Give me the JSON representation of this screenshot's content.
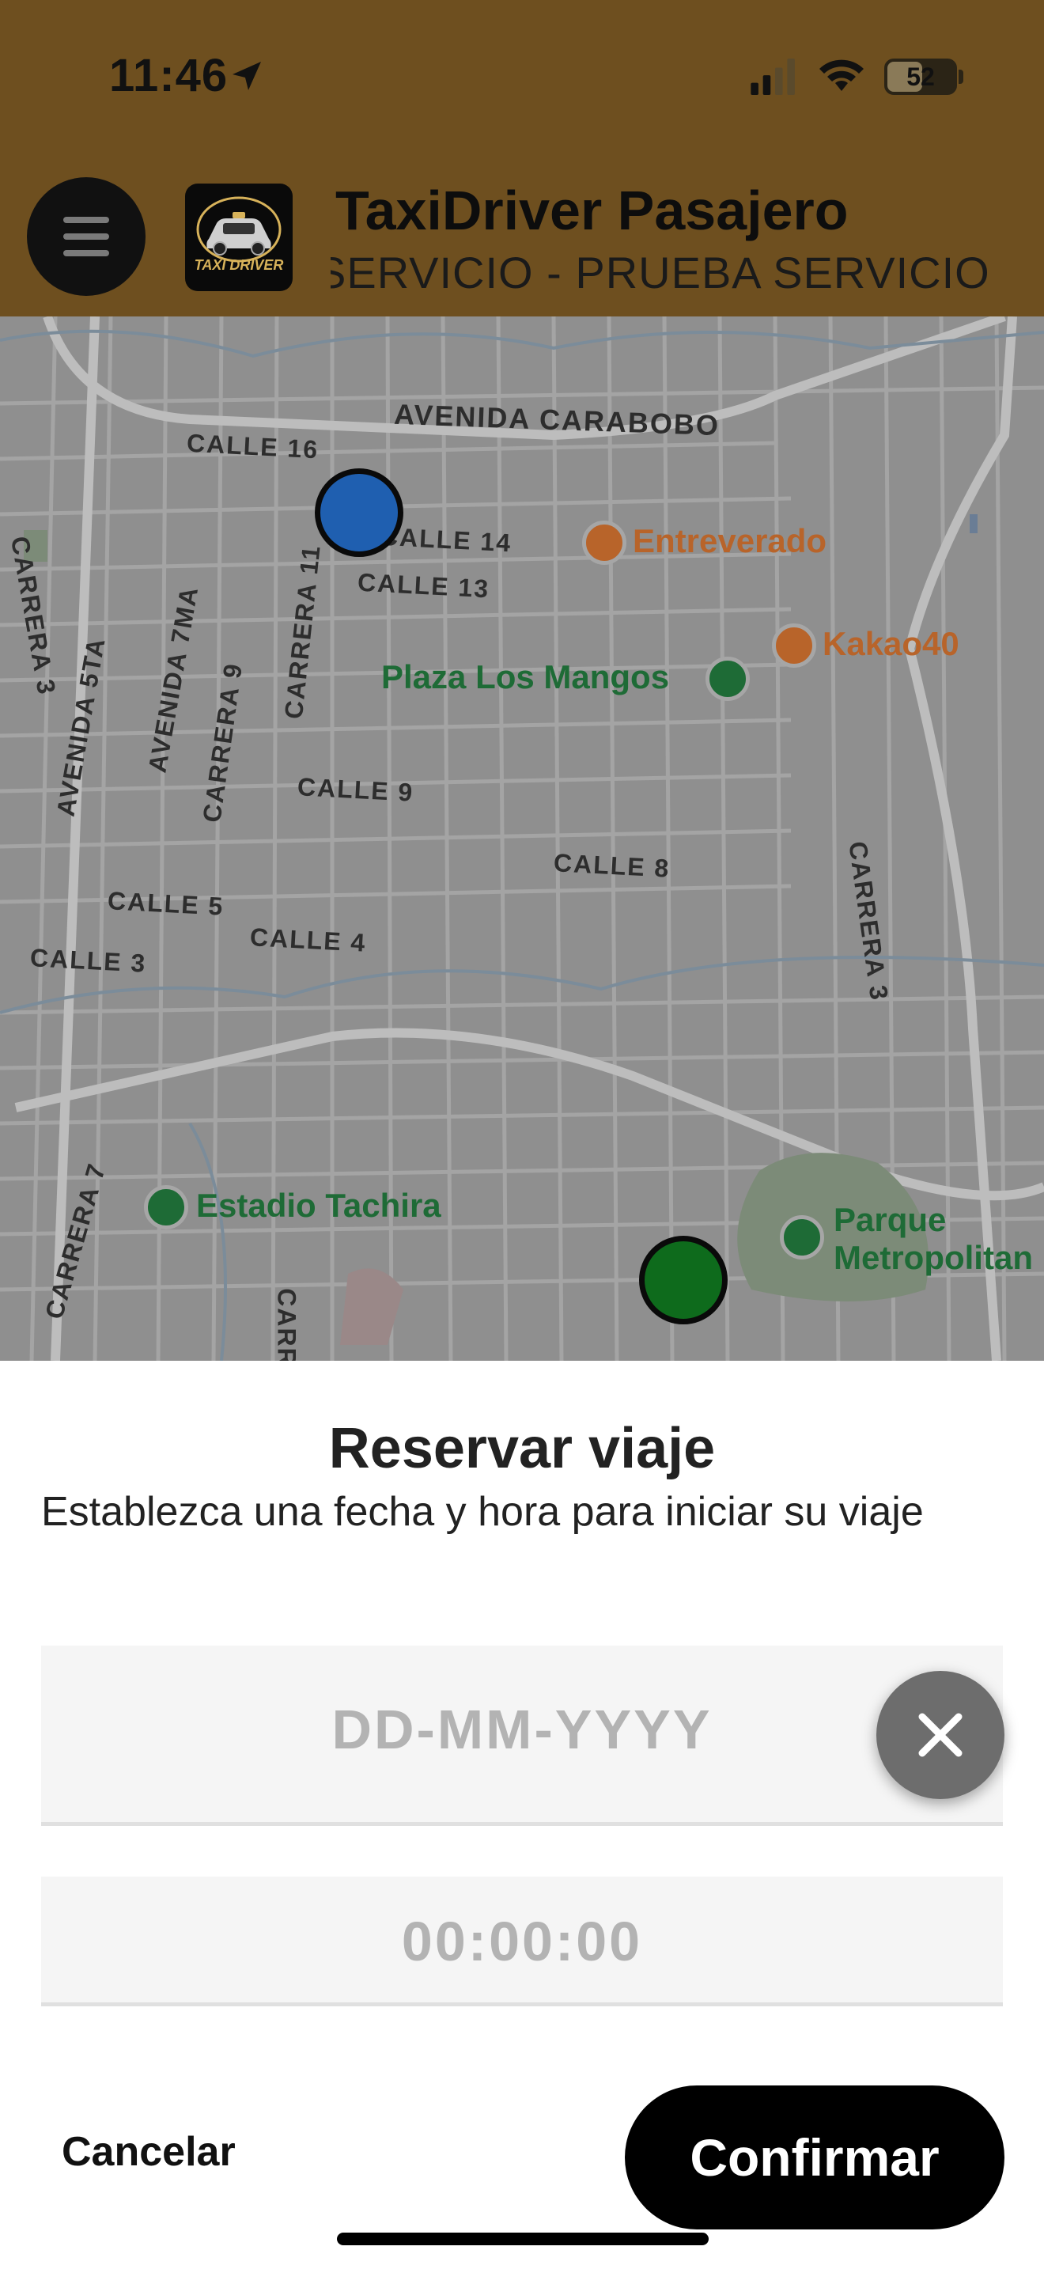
{
  "status_bar": {
    "time": "11:46",
    "battery": "52",
    "battery_level_pct": 52
  },
  "header": {
    "title": "TaxiDriver Pasajero",
    "subtitle": "SERVICIO - PRUEBA SERVICIO",
    "logo_text": "TAXI DRIVER",
    "bg_color": "#6e4f1f"
  },
  "map": {
    "street_labels": [
      "AVENIDA CARABOBO",
      "CALLE 16",
      "CALLE 14",
      "CALLE 13",
      "CALLE 9",
      "CALLE 8",
      "CALLE 5",
      "CALLE 4",
      "CALLE 3",
      "AVENIDA 5TA",
      "AVENIDA 7MA",
      "CARRERA 9",
      "CARRERA 11",
      "CARRERA 3",
      "CARRERA 7",
      "CARRERA 3",
      "CARR"
    ],
    "pois": [
      {
        "name": "Entreverado",
        "icon": "restaurant-icon",
        "color": "#b8642a"
      },
      {
        "name": "Kakao40",
        "icon": "ice-cream-icon",
        "color": "#b8642a"
      },
      {
        "name": "Plaza Los Mangos",
        "icon": "park-icon",
        "color": "#1e6b36"
      },
      {
        "name": "Estadio Tachira",
        "icon": "stadium-icon",
        "color": "#1e6b36"
      },
      {
        "name": "Parque Metropolitan",
        "icon": "tree-icon",
        "color": "#1e6b36"
      }
    ],
    "origin_pin_color": "#1f5fb0",
    "destination_pin_color": "#0e6b1c"
  },
  "sheet": {
    "title": "Reservar viaje",
    "subtitle": "Establezca una fecha y hora para iniciar su viaje",
    "date_placeholder": "DD-MM-YYYY",
    "time_placeholder": "00:00:00",
    "cancel_label": "Cancelar",
    "confirm_label": "Confirmar"
  }
}
